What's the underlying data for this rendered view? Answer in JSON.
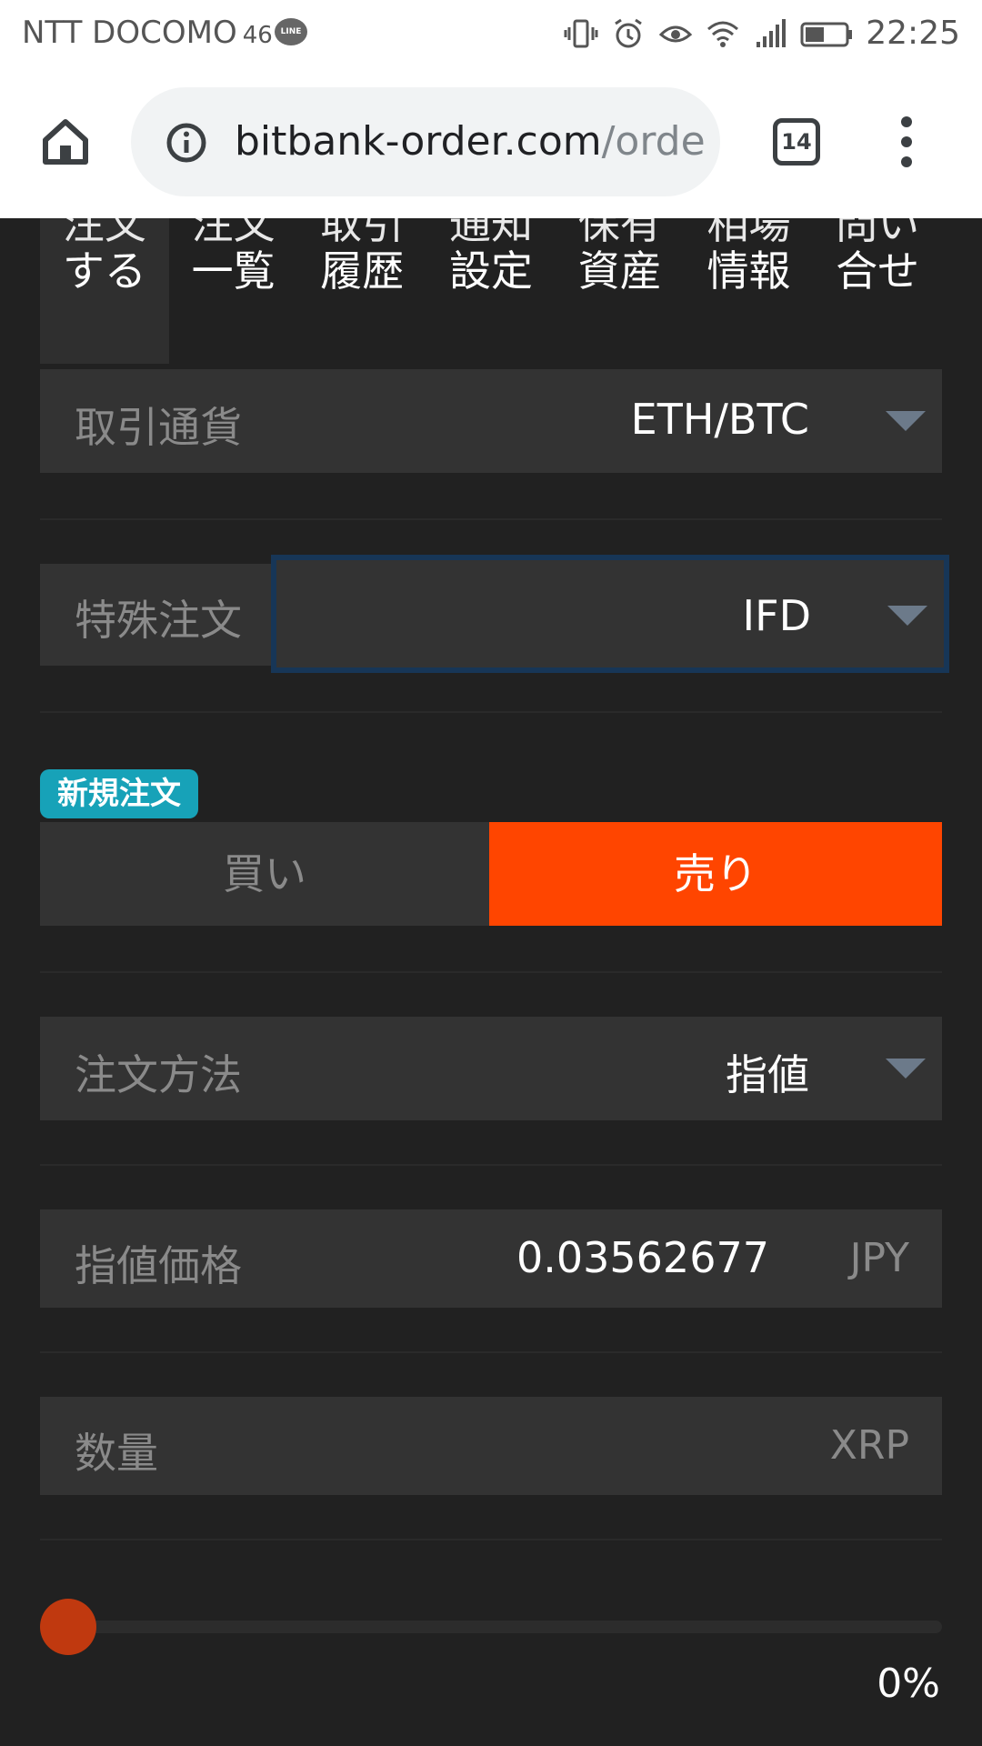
{
  "status_bar": {
    "carrier": "NTT DOCOMO",
    "network": "46",
    "line_icon_text": "LINE",
    "time": "22:25",
    "icons": [
      "vibrate-icon",
      "alarm-icon",
      "eye-comfort-icon",
      "wifi-icon",
      "signal-icon",
      "battery-icon"
    ]
  },
  "browser": {
    "url_host": "bitbank-order.com",
    "url_path": "/orde",
    "tab_count": "14"
  },
  "nav_tabs": [
    {
      "top": "注文",
      "bottom": "する",
      "active": true
    },
    {
      "top": "注文",
      "bottom": "一覧",
      "active": false
    },
    {
      "top": "取引",
      "bottom": "履歴",
      "active": false
    },
    {
      "top": "通知",
      "bottom": "設定",
      "active": false
    },
    {
      "top": "保有",
      "bottom": "資産",
      "active": false
    },
    {
      "top": "相場",
      "bottom": "情報",
      "active": false
    },
    {
      "top": "問い",
      "bottom": "合せ",
      "active": false
    }
  ],
  "form": {
    "pair_label": "取引通貨",
    "pair_value": "ETH/BTC",
    "special_label": "特殊注文",
    "special_value": "IFD",
    "new_order_badge": "新規注文",
    "buy_label": "買い",
    "sell_label": "売り",
    "selected_side": "sell",
    "method_label": "注文方法",
    "method_value": "指値",
    "price_label": "指値価格",
    "price_value": "0.03562677",
    "price_unit": "JPY",
    "amount_label": "数量",
    "amount_value": "",
    "amount_unit": "XRP"
  },
  "slider": {
    "value_percent": 0,
    "label": "0%"
  },
  "colors": {
    "background": "#212121",
    "field": "#333333",
    "sell_accent": "#ff4500",
    "badge": "#17a2b8",
    "slider": "#c0390f",
    "focus_border": "#173657"
  }
}
